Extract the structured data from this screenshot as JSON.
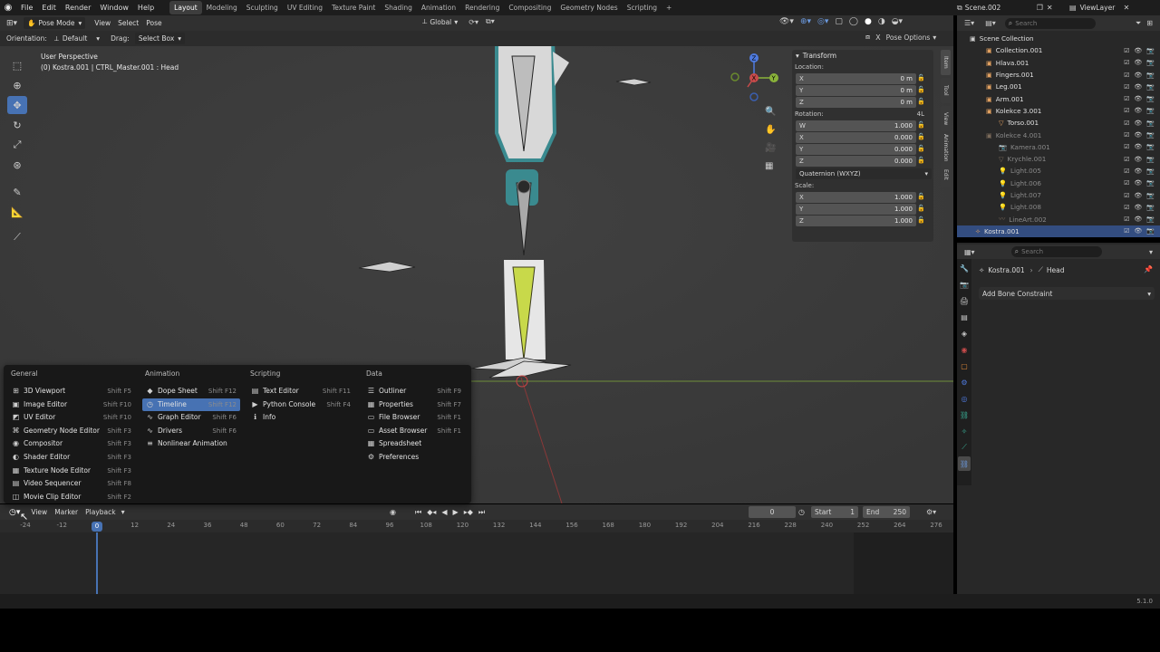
{
  "topbar": {
    "menus": [
      "File",
      "Edit",
      "Render",
      "Window",
      "Help"
    ],
    "workspaces": [
      "Layout",
      "Modeling",
      "Sculpting",
      "UV Editing",
      "Texture Paint",
      "Shading",
      "Animation",
      "Rendering",
      "Compositing",
      "Geometry Nodes",
      "Scripting",
      "+"
    ],
    "active_workspace": "Layout",
    "scene": "Scene.002",
    "view_layer": "ViewLayer"
  },
  "viewport_header": {
    "mode": "Pose Mode",
    "menus": [
      "View",
      "Select",
      "Pose"
    ],
    "transform_orientation": "Global",
    "orientation_label": "Orientation:",
    "orientation_value": "Default",
    "drag_label": "Drag:",
    "drag_value": "Select Box",
    "pose_options": "Pose Options"
  },
  "viewport": {
    "perspective": "User Perspective",
    "context": "(0) Kostra.001 | CTRL_Master.001 : Head"
  },
  "npanel": {
    "title": "Transform",
    "location_label": "Location:",
    "location": [
      {
        "k": "X",
        "v": "0 m"
      },
      {
        "k": "Y",
        "v": "0 m"
      },
      {
        "k": "Z",
        "v": "0 m"
      }
    ],
    "rotation_label": "Rotation:",
    "rotation_extra": "4L",
    "rotation": [
      {
        "k": "W",
        "v": "1.000"
      },
      {
        "k": "X",
        "v": "0.000"
      },
      {
        "k": "Y",
        "v": "0.000"
      },
      {
        "k": "Z",
        "v": "0.000"
      }
    ],
    "rotation_mode": "Quaternion (WXYZ)",
    "scale_label": "Scale:",
    "scale": [
      {
        "k": "X",
        "v": "1.000"
      },
      {
        "k": "Y",
        "v": "1.000"
      },
      {
        "k": "Z",
        "v": "1.000"
      }
    ],
    "tabs": [
      "Item",
      "Tool",
      "View",
      "Animation",
      "Edit"
    ]
  },
  "outliner": {
    "search_placeholder": "Search",
    "root": "Scene Collection",
    "rows": [
      {
        "label": "Collection.001",
        "dim": false,
        "sel": false
      },
      {
        "label": "Hlava.001",
        "dim": false,
        "sel": false
      },
      {
        "label": "Fingers.001",
        "dim": false,
        "sel": false
      },
      {
        "label": "Leg.001",
        "dim": false,
        "sel": false
      },
      {
        "label": "Arm.001",
        "dim": false,
        "sel": false
      },
      {
        "label": "Kolekce 3.001",
        "dim": false,
        "sel": false
      },
      {
        "label": "Torso.001",
        "dim": false,
        "sel": false
      },
      {
        "label": "Kolekce 4.001",
        "dim": true,
        "sel": false
      },
      {
        "label": "Kamera.001",
        "dim": true,
        "sel": false
      },
      {
        "label": "Krychle.001",
        "dim": true,
        "sel": false
      },
      {
        "label": "Light.005",
        "dim": true,
        "sel": false
      },
      {
        "label": "Light.006",
        "dim": true,
        "sel": false
      },
      {
        "label": "Light.007",
        "dim": true,
        "sel": false
      },
      {
        "label": "Light.008",
        "dim": true,
        "sel": false
      },
      {
        "label": "LineArt.002",
        "dim": true,
        "sel": false
      },
      {
        "label": "Kostra.001",
        "dim": false,
        "sel": true
      }
    ]
  },
  "properties": {
    "search_placeholder": "Search",
    "breadcrumb_object": "Kostra.001",
    "breadcrumb_bone": "Head",
    "add_constraint": "Add Bone Constraint"
  },
  "editor_menu": {
    "columns": [
      {
        "title": "General",
        "items": [
          {
            "label": "3D Viewport",
            "shortcut": "Shift F5",
            "icon": "⊞"
          },
          {
            "label": "Image Editor",
            "shortcut": "Shift F10",
            "icon": "▣"
          },
          {
            "label": "UV Editor",
            "shortcut": "Shift F10",
            "icon": "◩"
          },
          {
            "label": "Geometry Node Editor",
            "shortcut": "Shift F3",
            "icon": "⌘"
          },
          {
            "label": "Compositor",
            "shortcut": "Shift F3",
            "icon": "◉"
          },
          {
            "label": "Shader Editor",
            "shortcut": "Shift F3",
            "icon": "◐"
          },
          {
            "label": "Texture Node Editor",
            "shortcut": "Shift F3",
            "icon": "▦"
          },
          {
            "label": "Video Sequencer",
            "shortcut": "Shift F8",
            "icon": "▤"
          },
          {
            "label": "Movie Clip Editor",
            "shortcut": "Shift F2",
            "icon": "◫"
          }
        ]
      },
      {
        "title": "Animation",
        "items": [
          {
            "label": "Dope Sheet",
            "shortcut": "Shift F12",
            "icon": "◆"
          },
          {
            "label": "Timeline",
            "shortcut": "Shift F12",
            "icon": "◷",
            "highlight": true
          },
          {
            "label": "Graph Editor",
            "shortcut": "Shift F6",
            "icon": "∿"
          },
          {
            "label": "Drivers",
            "shortcut": "Shift F6",
            "icon": "∿"
          },
          {
            "label": "Nonlinear Animation",
            "shortcut": "",
            "icon": "≡"
          }
        ]
      },
      {
        "title": "Scripting",
        "items": [
          {
            "label": "Text Editor",
            "shortcut": "Shift F11",
            "icon": "▤"
          },
          {
            "label": "Python Console",
            "shortcut": "Shift F4",
            "icon": "▶"
          },
          {
            "label": "Info",
            "shortcut": "",
            "icon": "ℹ"
          }
        ]
      },
      {
        "title": "Data",
        "items": [
          {
            "label": "Outliner",
            "shortcut": "Shift F9",
            "icon": "☰"
          },
          {
            "label": "Properties",
            "shortcut": "Shift F7",
            "icon": "▦"
          },
          {
            "label": "File Browser",
            "shortcut": "Shift F1",
            "icon": "▭"
          },
          {
            "label": "Asset Browser",
            "shortcut": "Shift F1",
            "icon": "▭"
          },
          {
            "label": "Spreadsheet",
            "shortcut": "",
            "icon": "▦"
          },
          {
            "label": "Preferences",
            "shortcut": "",
            "icon": "⚙"
          }
        ]
      }
    ]
  },
  "timeline": {
    "menus": [
      "View",
      "Marker",
      "Playback"
    ],
    "current_frame": "0",
    "start_label": "Start",
    "start": "1",
    "end_label": "End",
    "end": "250",
    "ticks": [
      "-24",
      "-12",
      "0",
      "12",
      "24",
      "36",
      "48",
      "60",
      "72",
      "84",
      "96",
      "108",
      "120",
      "132",
      "144",
      "156",
      "168",
      "180",
      "192",
      "204",
      "216",
      "228",
      "240",
      "252",
      "264",
      "276"
    ]
  },
  "status": {
    "version": "5.1.0"
  },
  "colors": {
    "accent": "#4772b3",
    "selected_row": "#334d80",
    "bone_yellow": "#c8d94a",
    "armature_teal": "#3a8a8f"
  }
}
